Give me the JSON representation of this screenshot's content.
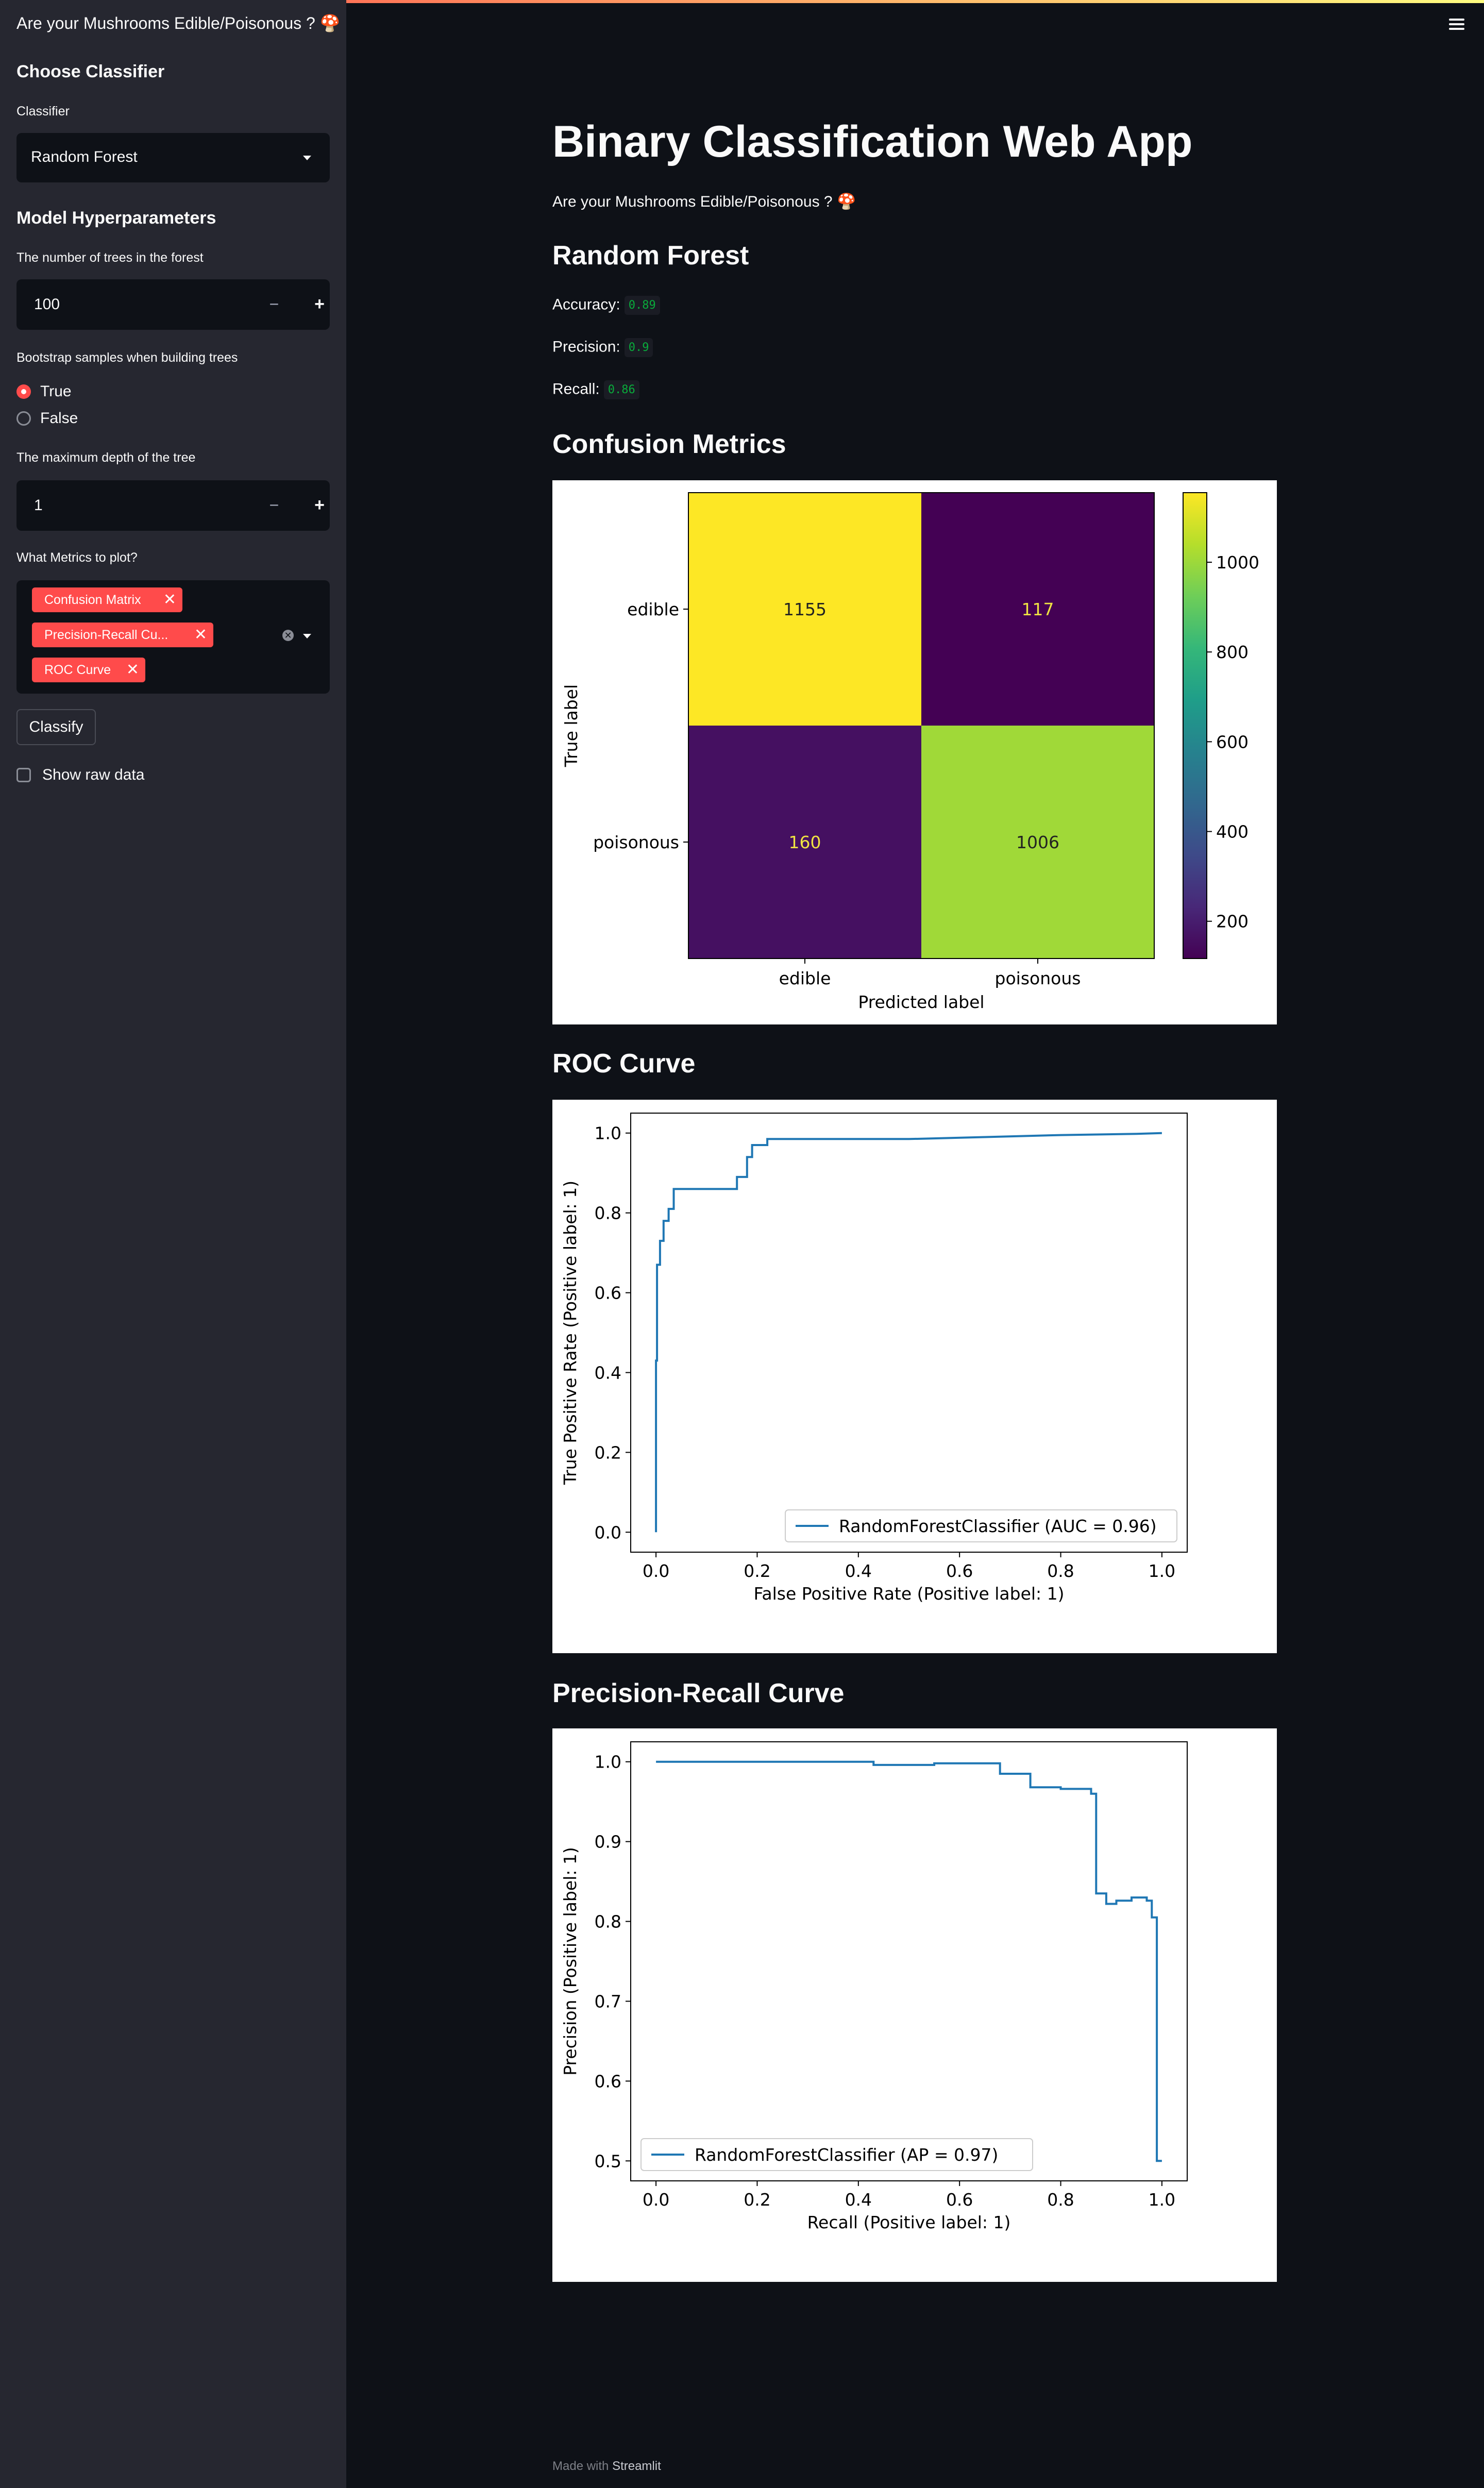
{
  "app_title": "Are your Mushrooms Edible/Poisonous ? 🍄",
  "sidebar": {
    "choose_classifier": "Choose Classifier",
    "classifier_label": "Classifier",
    "classifier_value": "Random Forest",
    "hyperparams_heading": "Model Hyperparameters",
    "n_trees_label": "The number of trees in the forest",
    "n_trees_value": "100",
    "bootstrap_label": "Bootstrap samples when building trees",
    "bootstrap_options": [
      "True",
      "False"
    ],
    "bootstrap_selected": "True",
    "max_depth_label": "The maximum depth of the tree",
    "max_depth_value": "1",
    "metrics_label": "What Metrics to plot?",
    "metrics_selected": [
      "Confusion Matrix",
      "Precision-Recall Cu...",
      "ROC Curve"
    ],
    "classify_button": "Classify",
    "show_raw_label": "Show raw data",
    "minus": "−",
    "plus": "+",
    "chip_close": "✕",
    "clear_all": "✕"
  },
  "main": {
    "title": "Binary Classification Web App",
    "subtitle": "Are your Mushrooms Edible/Poisonous ? 🍄",
    "model_heading": "Random Forest",
    "accuracy_label": "Accuracy:",
    "accuracy_value": "0.89",
    "precision_label": "Precision:",
    "precision_value": "0.9",
    "recall_label": "Recall:",
    "recall_value": "0.86",
    "confusion_heading": "Confusion Metrics",
    "roc_heading": "ROC Curve",
    "pr_heading": "Precision-Recall Curve"
  },
  "footer": {
    "prefix": "Made with",
    "brand": "Streamlit"
  },
  "colors": {
    "accent": "#ff4b4b",
    "background": "#0e1117",
    "sidebar": "#262730",
    "line": "#1f77b4"
  },
  "chart_data": [
    {
      "type": "heatmap",
      "xlabel": "Predicted label",
      "ylabel": "True label",
      "x_categories": [
        "edible",
        "poisonous"
      ],
      "y_categories": [
        "edible",
        "poisonous"
      ],
      "values": [
        [
          1155,
          117
        ],
        [
          160,
          1006
        ]
      ],
      "colorbar_ticks": [
        200,
        400,
        600,
        800,
        1000
      ],
      "colormap": "viridis"
    },
    {
      "type": "line",
      "xlabel": "False Positive Rate (Positive label: 1)",
      "ylabel": "True Positive Rate (Positive label: 1)",
      "xlim": [
        -0.05,
        1.05
      ],
      "ylim": [
        -0.05,
        1.05
      ],
      "xticks": [
        "0.0",
        "0.2",
        "0.4",
        "0.6",
        "0.8",
        "1.0"
      ],
      "yticks": [
        "0.0",
        "0.2",
        "0.4",
        "0.6",
        "0.8",
        "1.0"
      ],
      "legend": "RandomForestClassifier (AUC = 0.96)",
      "legend_position": "lower right",
      "series": [
        {
          "name": "RandomForestClassifier (AUC = 0.96)",
          "x": [
            0.0,
            0.0,
            0.0,
            0.002,
            0.002,
            0.008,
            0.008,
            0.015,
            0.015,
            0.025,
            0.025,
            0.035,
            0.035,
            0.16,
            0.16,
            0.18,
            0.18,
            0.19,
            0.19,
            0.22,
            0.22,
            0.5,
            0.65,
            0.8,
            0.95,
            1.0
          ],
          "y": [
            0.0,
            0.43,
            0.43,
            0.43,
            0.67,
            0.67,
            0.73,
            0.73,
            0.78,
            0.78,
            0.81,
            0.81,
            0.86,
            0.86,
            0.89,
            0.89,
            0.94,
            0.94,
            0.97,
            0.97,
            0.985,
            0.985,
            0.99,
            0.995,
            0.998,
            1.0
          ]
        }
      ]
    },
    {
      "type": "line",
      "xlabel": "Recall (Positive label: 1)",
      "ylabel": "Precision (Positive label: 1)",
      "xlim": [
        -0.05,
        1.05
      ],
      "ylim": [
        0.475,
        1.025
      ],
      "xticks": [
        "0.0",
        "0.2",
        "0.4",
        "0.6",
        "0.8",
        "1.0"
      ],
      "yticks": [
        "0.5",
        "0.6",
        "0.7",
        "0.8",
        "0.9",
        "1.0"
      ],
      "legend": "RandomForestClassifier (AP = 0.97)",
      "legend_position": "lower left",
      "series": [
        {
          "name": "RandomForestClassifier (AP = 0.97)",
          "x": [
            0.0,
            0.43,
            0.43,
            0.55,
            0.55,
            0.68,
            0.68,
            0.74,
            0.74,
            0.8,
            0.8,
            0.86,
            0.86,
            0.87,
            0.87,
            0.89,
            0.89,
            0.91,
            0.91,
            0.94,
            0.94,
            0.97,
            0.97,
            0.98,
            0.98,
            0.99,
            0.99,
            1.0
          ],
          "y": [
            1.0,
            1.0,
            0.996,
            0.996,
            0.998,
            0.998,
            0.985,
            0.985,
            0.968,
            0.968,
            0.966,
            0.966,
            0.96,
            0.96,
            0.835,
            0.835,
            0.822,
            0.822,
            0.826,
            0.826,
            0.83,
            0.83,
            0.826,
            0.826,
            0.805,
            0.805,
            0.5,
            0.5
          ]
        }
      ]
    }
  ]
}
